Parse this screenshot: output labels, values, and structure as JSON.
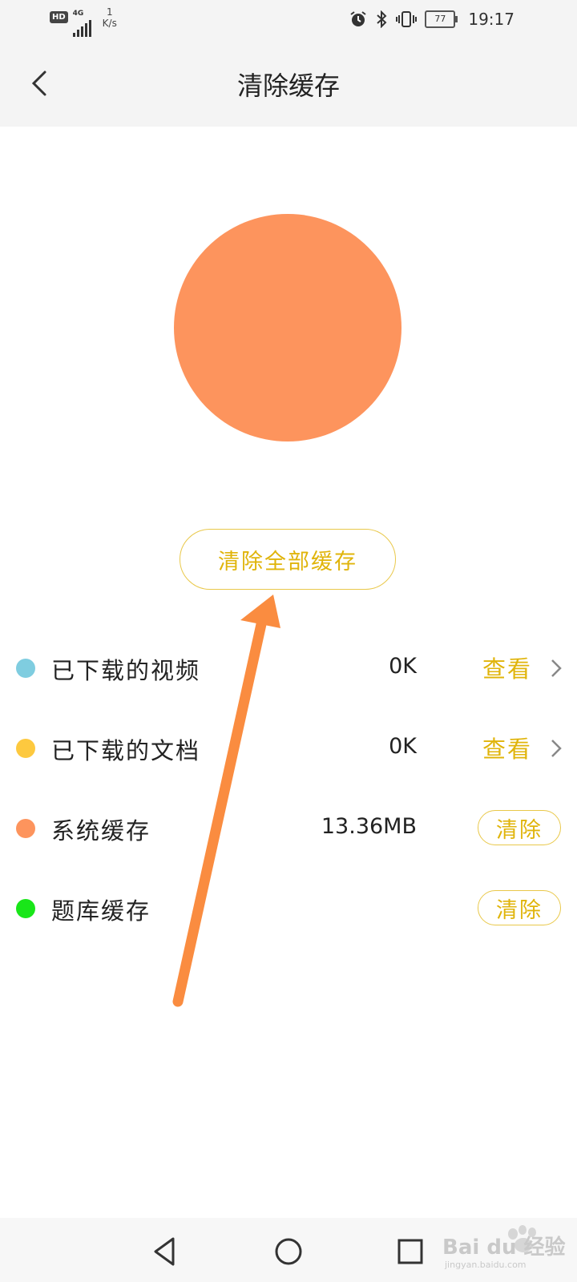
{
  "status_bar": {
    "hd_label": "HD",
    "network_type": "4G",
    "speed_value": "1",
    "speed_unit": "K/s",
    "battery_level": "77",
    "time": "19:17",
    "icons": [
      "alarm-icon",
      "bluetooth-icon",
      "vibrate-icon",
      "battery-icon"
    ]
  },
  "header": {
    "title": "清除缓存",
    "back_icon": "chevron-left-icon"
  },
  "pie_chart": {
    "color": "#fd945d"
  },
  "clear_all_button": {
    "label": "清除全部缓存"
  },
  "cache_items": [
    {
      "label": "已下载的视频",
      "size": "0K",
      "action": "查看",
      "dot_color": "#7fcde0"
    },
    {
      "label": "已下载的文档",
      "size": "0K",
      "action": "查看",
      "dot_color": "#fdc93f"
    },
    {
      "label": "系统缓存",
      "size": "13.36MB",
      "action": "清除",
      "dot_color": "#fd945d"
    },
    {
      "label": "题库缓存",
      "size": "",
      "action": "清除",
      "dot_color": "#19e619"
    }
  ],
  "annotation": {
    "arrow_color": "#fa8c40"
  },
  "nav_bar": {
    "buttons": [
      "back-triangle-icon",
      "home-circle-icon",
      "recents-square-icon"
    ]
  },
  "watermark": {
    "text": "Bai du 经验",
    "sub": "jingyan.baidu.com"
  },
  "accent_color": "#e0b40a"
}
